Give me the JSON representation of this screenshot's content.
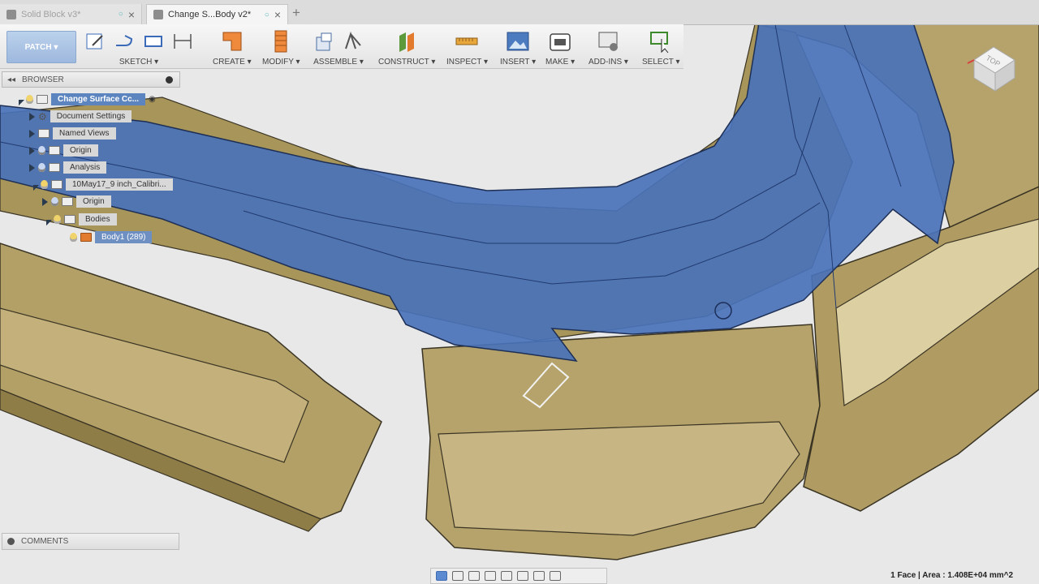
{
  "tabs": [
    {
      "label": "Solid Block v3*",
      "active": false
    },
    {
      "label": "Change S...Body v2*",
      "active": true
    }
  ],
  "toolbar": {
    "workspace": "PATCH",
    "groups": {
      "sketch": "SKETCH",
      "create": "CREATE",
      "modify": "MODIFY",
      "assemble": "ASSEMBLE",
      "construct": "CONSTRUCT",
      "inspect": "INSPECT",
      "insert": "INSERT",
      "make": "MAKE",
      "addins": "ADD-INS",
      "select": "SELECT"
    }
  },
  "browser": {
    "title": "BROWSER",
    "items": [
      {
        "label": "Change Surface Cc..."
      },
      {
        "label": "Document Settings"
      },
      {
        "label": "Named Views"
      },
      {
        "label": "Origin"
      },
      {
        "label": "Analysis"
      },
      {
        "label": "10May17_9 inch_Calibri..."
      },
      {
        "label": "Origin"
      },
      {
        "label": "Bodies"
      },
      {
        "label": "Body1 (289)"
      }
    ]
  },
  "comments": {
    "label": "COMMENTS"
  },
  "viewcube": {
    "face": "TOP"
  },
  "status": {
    "text": "1 Face | Area : 1.408E+04 mm^2"
  },
  "colors": {
    "selection": "#4a72b8",
    "body": "#b8a46a",
    "accent": "#5b8ad0"
  }
}
